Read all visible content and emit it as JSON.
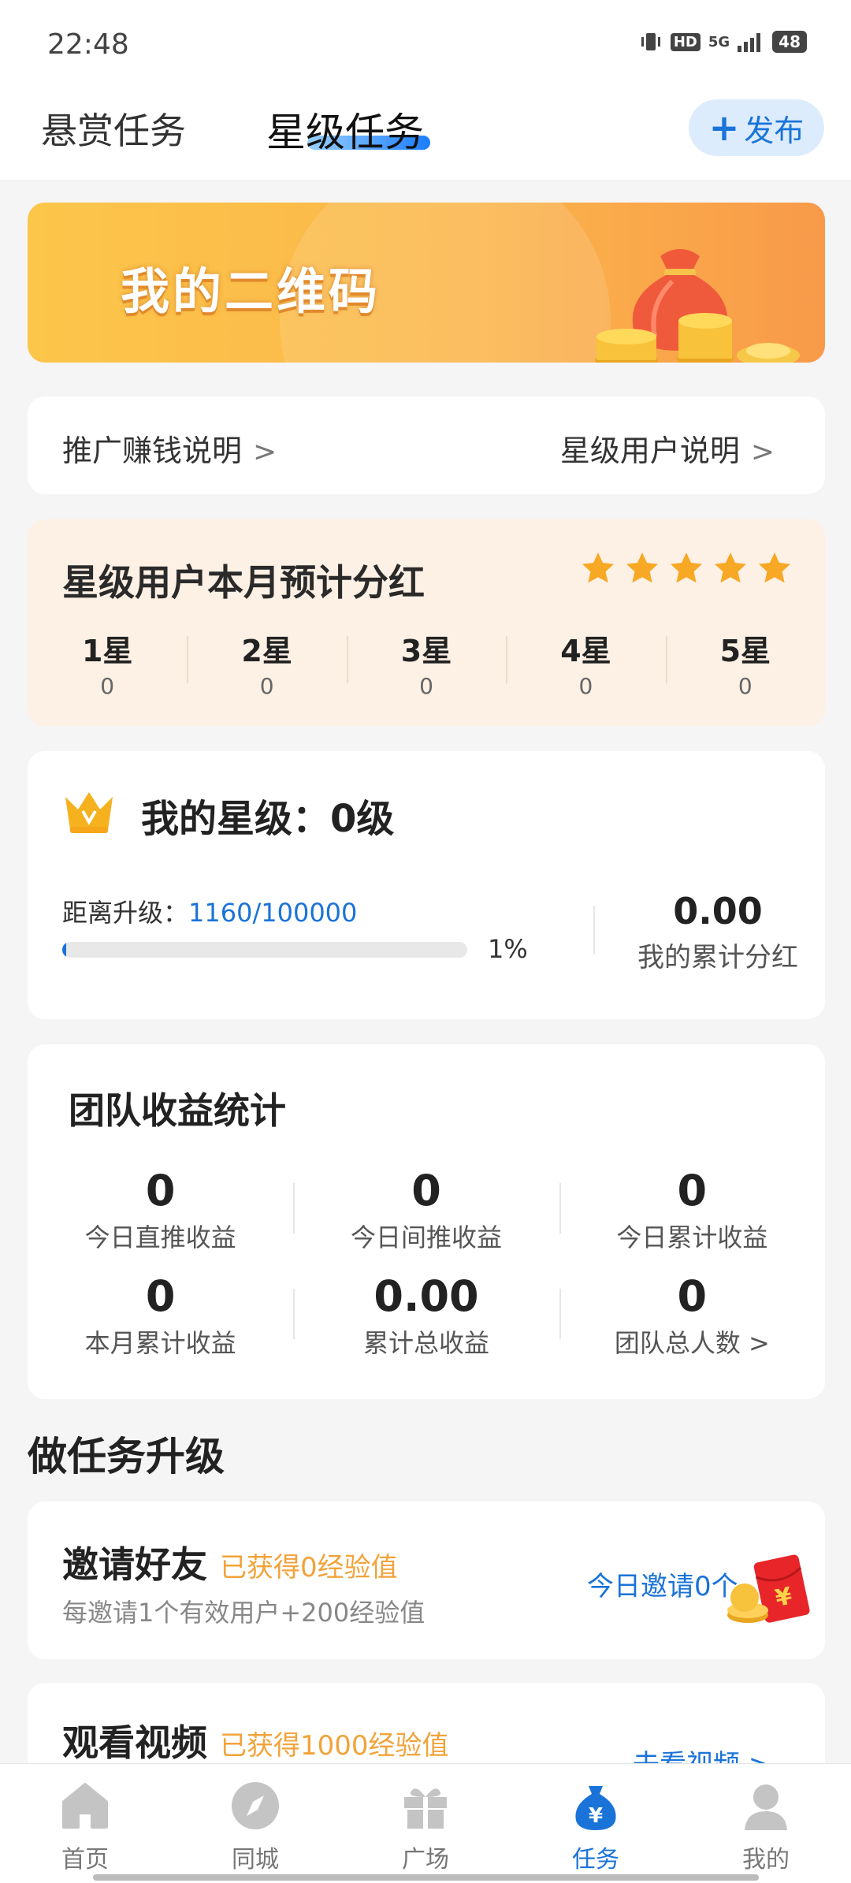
{
  "status_bar": {
    "time": "22:48",
    "hd": "HD",
    "network": "5G",
    "battery": "48"
  },
  "header": {
    "tabs": [
      {
        "label": "悬赏任务"
      },
      {
        "label": "星级任务"
      }
    ],
    "publish_label": "发布"
  },
  "banner": {
    "title": "我的二维码"
  },
  "promo": {
    "left": "推广赚钱说明",
    "right": "星级用户说明"
  },
  "star_bonus": {
    "title": "星级用户本月预计分红",
    "rating": 5,
    "levels": [
      {
        "label": "1星",
        "value": "0"
      },
      {
        "label": "2星",
        "value": "0"
      },
      {
        "label": "3星",
        "value": "0"
      },
      {
        "label": "4星",
        "value": "0"
      },
      {
        "label": "5星",
        "value": "0"
      }
    ]
  },
  "level": {
    "title": "我的星级：0级",
    "distance_label": "距离升级：",
    "distance_value": "1160/100000",
    "progress_percent": 1,
    "progress_text": "1%",
    "cumulative_value": "0.00",
    "cumulative_label": "我的累计分红"
  },
  "team": {
    "title": "团队收益统计",
    "stats": [
      {
        "value": "0",
        "label": "今日直推收益"
      },
      {
        "value": "0",
        "label": "今日间推收益"
      },
      {
        "value": "0",
        "label": "今日累计收益"
      },
      {
        "value": "0",
        "label": "本月累计收益"
      },
      {
        "value": "0.00",
        "label": "累计总收益"
      },
      {
        "value": "0",
        "label": "团队总人数 >"
      }
    ]
  },
  "tasks": {
    "section_title": "做任务升级",
    "invite": {
      "title": "邀请好友",
      "badge": "已获得0经验值",
      "desc": "每邀请1个有效用户+200经验值",
      "action": "今日邀请0个"
    },
    "video": {
      "title": "观看视频",
      "badge": "已获得1000经验值",
      "action": "去看视频 >"
    }
  },
  "bottom_nav": [
    {
      "label": "首页",
      "icon": "home-icon"
    },
    {
      "label": "同城",
      "icon": "compass-icon"
    },
    {
      "label": "广场",
      "icon": "gift-icon"
    },
    {
      "label": "任务",
      "icon": "task-money-bag-icon",
      "active": true
    },
    {
      "label": "我的",
      "icon": "user-icon"
    }
  ],
  "colors": {
    "accent": "#1a73d9",
    "gold": "#f2a33a",
    "banner": "#fbb64a",
    "star_card_bg": "#fdf0e4"
  }
}
